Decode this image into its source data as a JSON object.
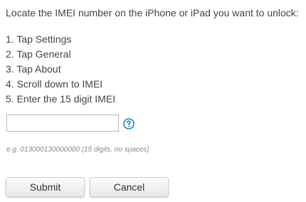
{
  "intro": "Locate the IMEI number on the iPhone or iPad you want to unlock:",
  "steps": [
    "1. Tap Settings",
    "2. Tap General",
    "3. Tap About",
    "4. Scroll down to IMEI",
    "5. Enter the 15 digit IMEI"
  ],
  "imei_input": {
    "value": "",
    "placeholder": ""
  },
  "help_icon": "question-circle-icon",
  "hint": "e.g. 013000130000000 (15 digits, no spaces)",
  "buttons": {
    "submit": "Submit",
    "cancel": "Cancel"
  },
  "colors": {
    "text": "#444444",
    "hint": "#888888",
    "help_icon": "#1a86b8"
  }
}
